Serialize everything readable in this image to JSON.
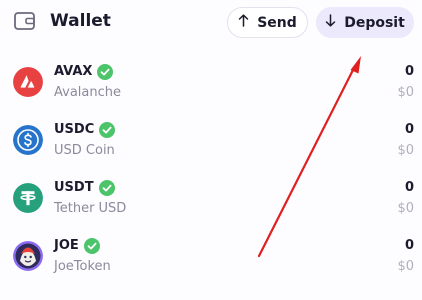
{
  "header": {
    "title": "Wallet",
    "title_icon": "wallet-icon",
    "send_label": "Send",
    "send_icon": "arrow-up-icon",
    "deposit_label": "Deposit",
    "deposit_icon": "arrow-down-icon"
  },
  "tokens": [
    {
      "symbol": "AVAX",
      "name": "Avalanche",
      "amount": "0",
      "value": "$0",
      "logo": "avax-logo-icon",
      "logo_color": "#e84142",
      "verified": true
    },
    {
      "symbol": "USDC",
      "name": "USD Coin",
      "amount": "0",
      "value": "$0",
      "logo": "usdc-logo-icon",
      "logo_color": "#2775ca",
      "verified": true
    },
    {
      "symbol": "USDT",
      "name": "Tether USD",
      "amount": "0",
      "value": "$0",
      "logo": "usdt-logo-icon",
      "logo_color": "#26a17b",
      "verified": true
    },
    {
      "symbol": "JOE",
      "name": "JoeToken",
      "amount": "0",
      "value": "$0",
      "logo": "joe-logo-icon",
      "logo_color": "#8c6cf0",
      "verified": true
    }
  ],
  "colors": {
    "verified": "#4cc46a",
    "annotation_arrow": "#e02020",
    "deposit_button_bg": "#ebe9fb"
  }
}
